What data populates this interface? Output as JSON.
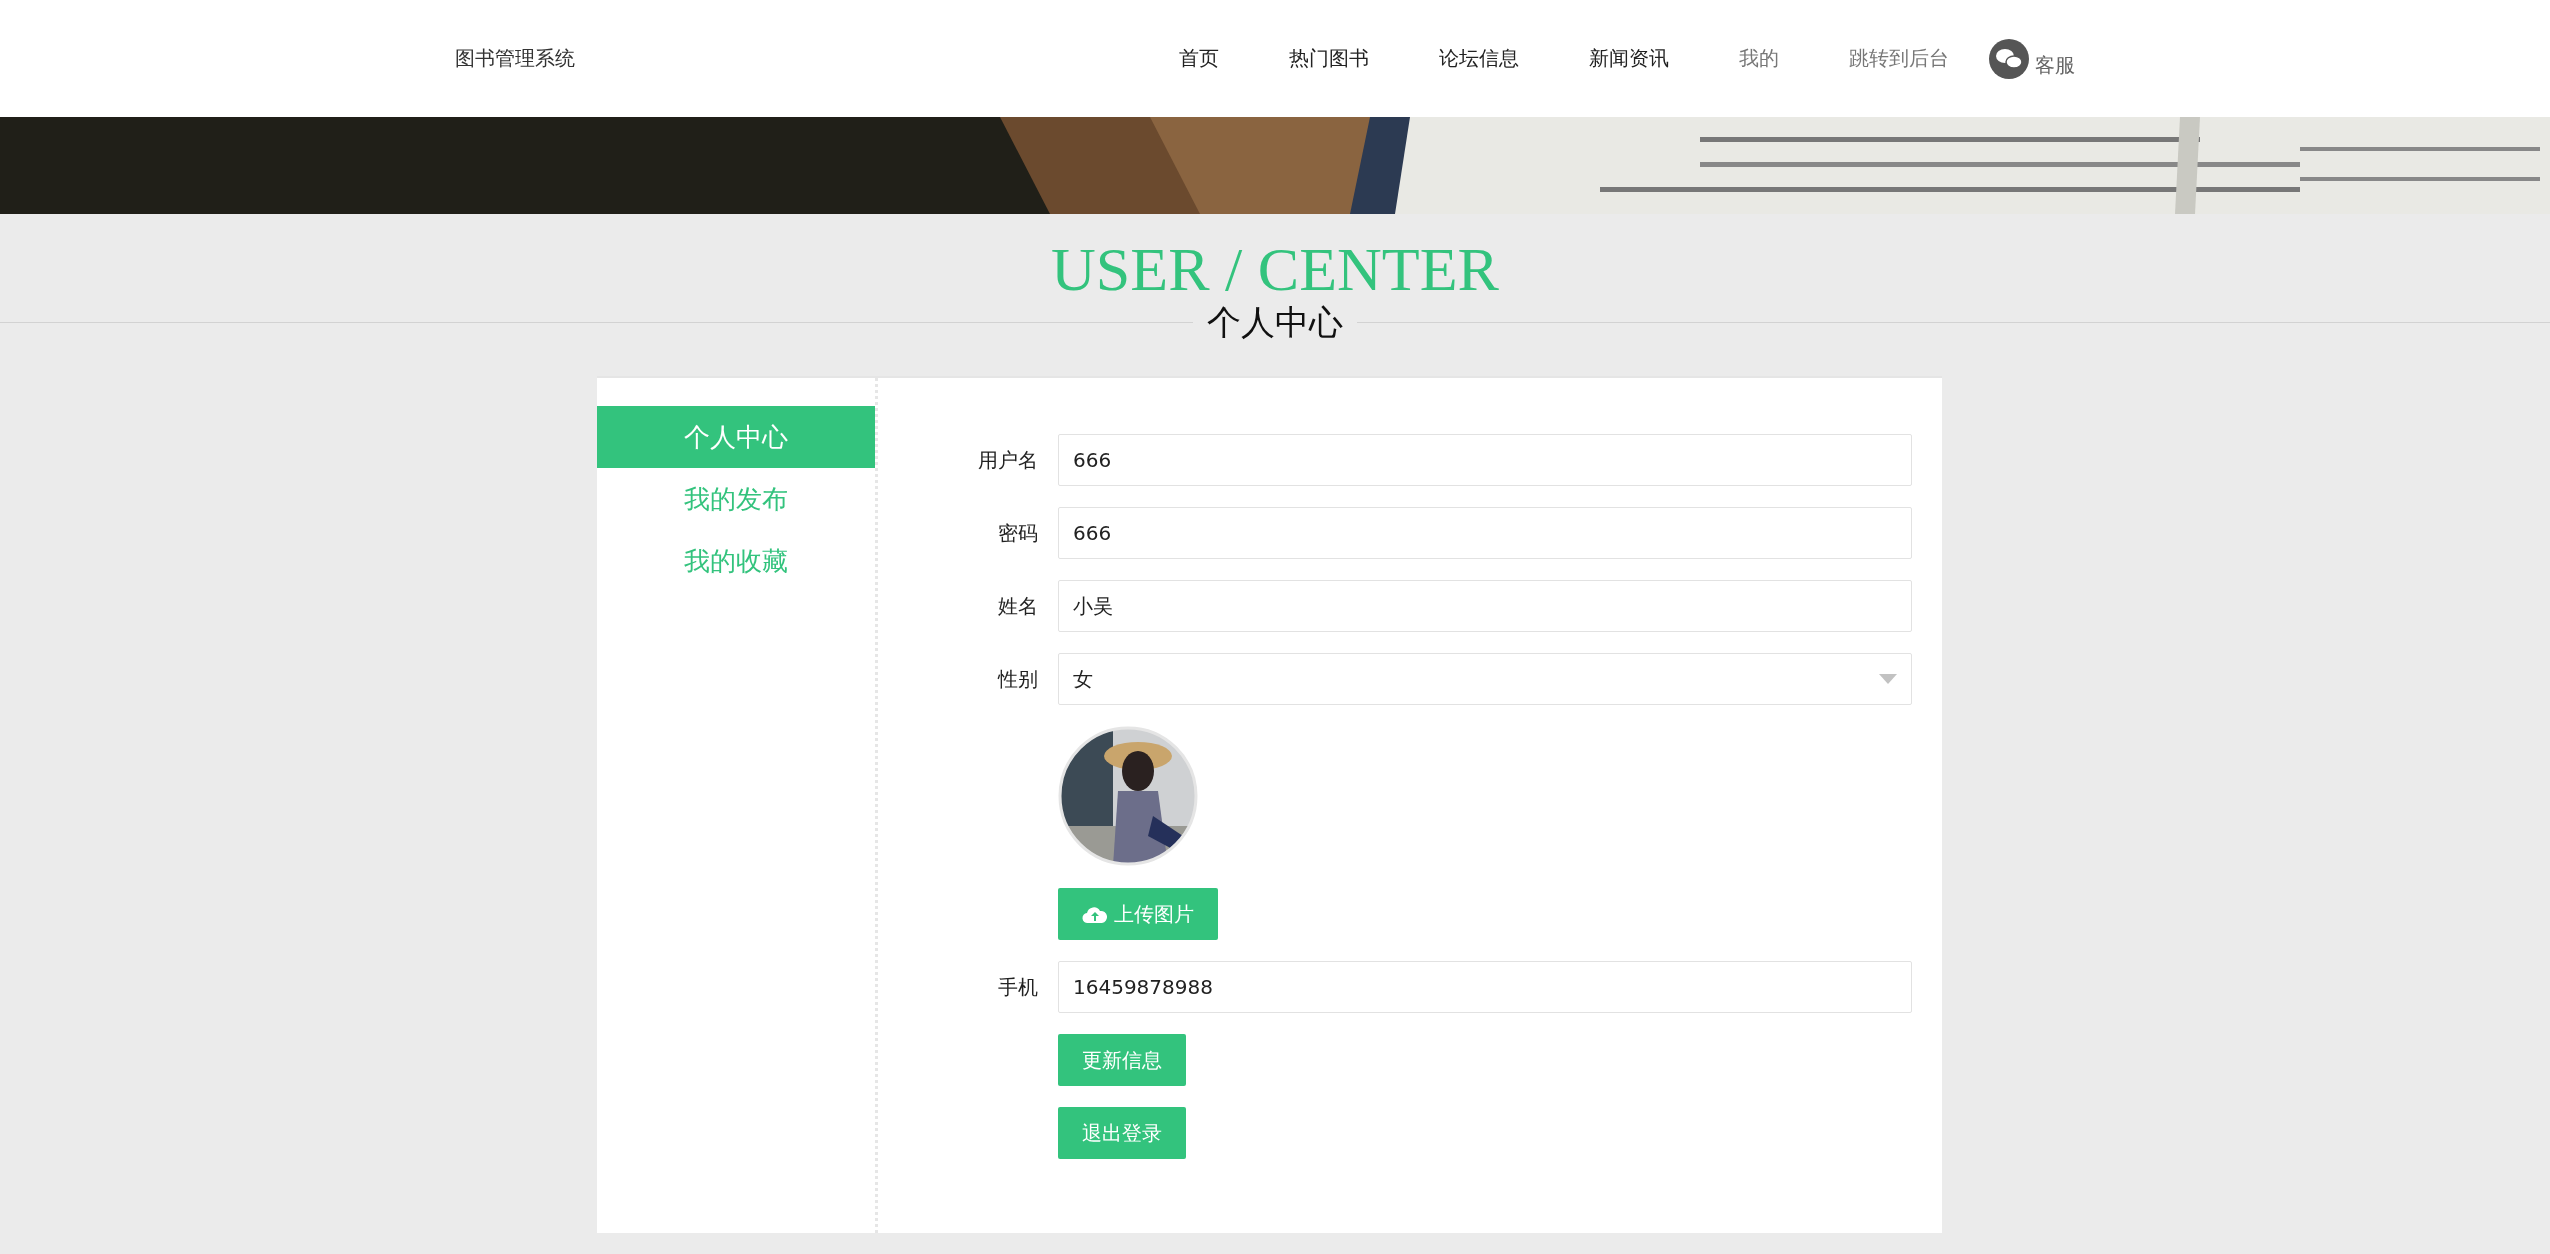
{
  "header": {
    "site_title": "图书管理系统",
    "nav": [
      {
        "label": "首页",
        "dimmed": false
      },
      {
        "label": "热门图书",
        "dimmed": false
      },
      {
        "label": "论坛信息",
        "dimmed": false
      },
      {
        "label": "新闻资讯",
        "dimmed": false
      },
      {
        "label": "我的",
        "dimmed": true
      },
      {
        "label": "跳转到后台",
        "dimmed": true
      }
    ],
    "service": "客服"
  },
  "heading": {
    "title": "USER / CENTER",
    "subtitle": "个人中心"
  },
  "sidebar": {
    "items": [
      {
        "label": "个人中心",
        "selected": true
      },
      {
        "label": "我的发布",
        "selected": false
      },
      {
        "label": "我的收藏",
        "selected": false
      }
    ]
  },
  "form": {
    "fields": [
      {
        "kind": "text",
        "label": "用户名",
        "value": "666"
      },
      {
        "kind": "text",
        "label": "密码",
        "value": "666"
      },
      {
        "kind": "text",
        "label": "姓名",
        "value": "小吴"
      },
      {
        "kind": "select",
        "label": "性别",
        "value": "女"
      },
      {
        "kind": "avatar",
        "button": "上传图片"
      },
      {
        "kind": "text",
        "label": "手机",
        "value": "16459878988"
      }
    ],
    "buttons": [
      "更新信息",
      "退出登录"
    ]
  }
}
